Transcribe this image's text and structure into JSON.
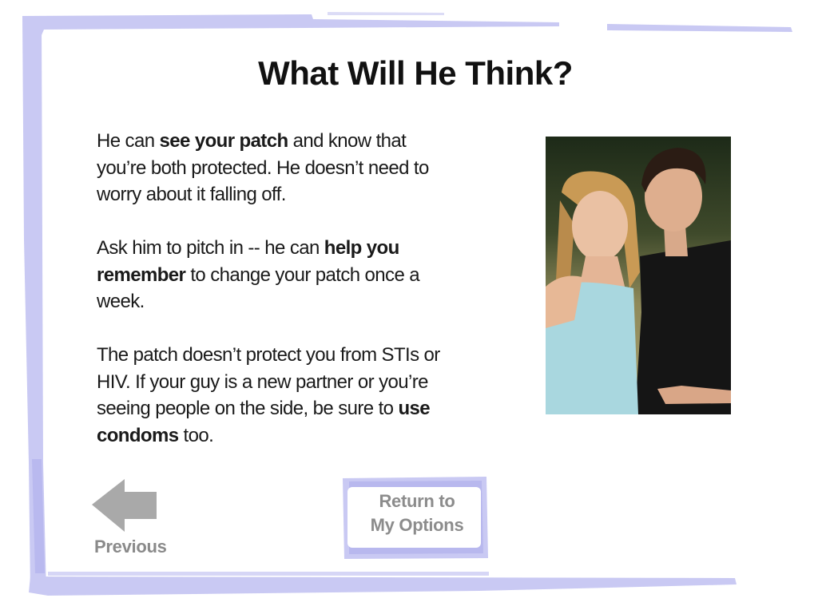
{
  "page": {
    "title": "What Will He Think?"
  },
  "paragraphs": [
    [
      {
        "text": "He can ",
        "bold": false
      },
      {
        "text": "see your patch",
        "bold": true
      },
      {
        "text": " and know that you’re both protected. He doesn’t need to worry about it falling off.",
        "bold": false
      }
    ],
    [
      {
        "text": "Ask him to pitch in -- he can ",
        "bold": false
      },
      {
        "text": "help you remember",
        "bold": true
      },
      {
        "text": " to change your patch once a week.",
        "bold": false
      }
    ],
    [
      {
        "text": "The patch doesn’t protect you from STIs or HIV. If your guy is a new partner or you’re seeing people on the side, be sure to ",
        "bold": false
      },
      {
        "text": "use condoms",
        "bold": true
      },
      {
        "text": " too.",
        "bold": false
      }
    ]
  ],
  "navigation": {
    "previous_label": "Previous",
    "return_line1": "Return to",
    "return_line2": "My Options"
  },
  "icons": {
    "previous": "left-arrow-icon"
  },
  "colors": {
    "frame": "#c9c9f3",
    "button_frame": "#c9c9f3",
    "arrow": "#a9a9a9",
    "nav_text": "#8a8a8a"
  }
}
